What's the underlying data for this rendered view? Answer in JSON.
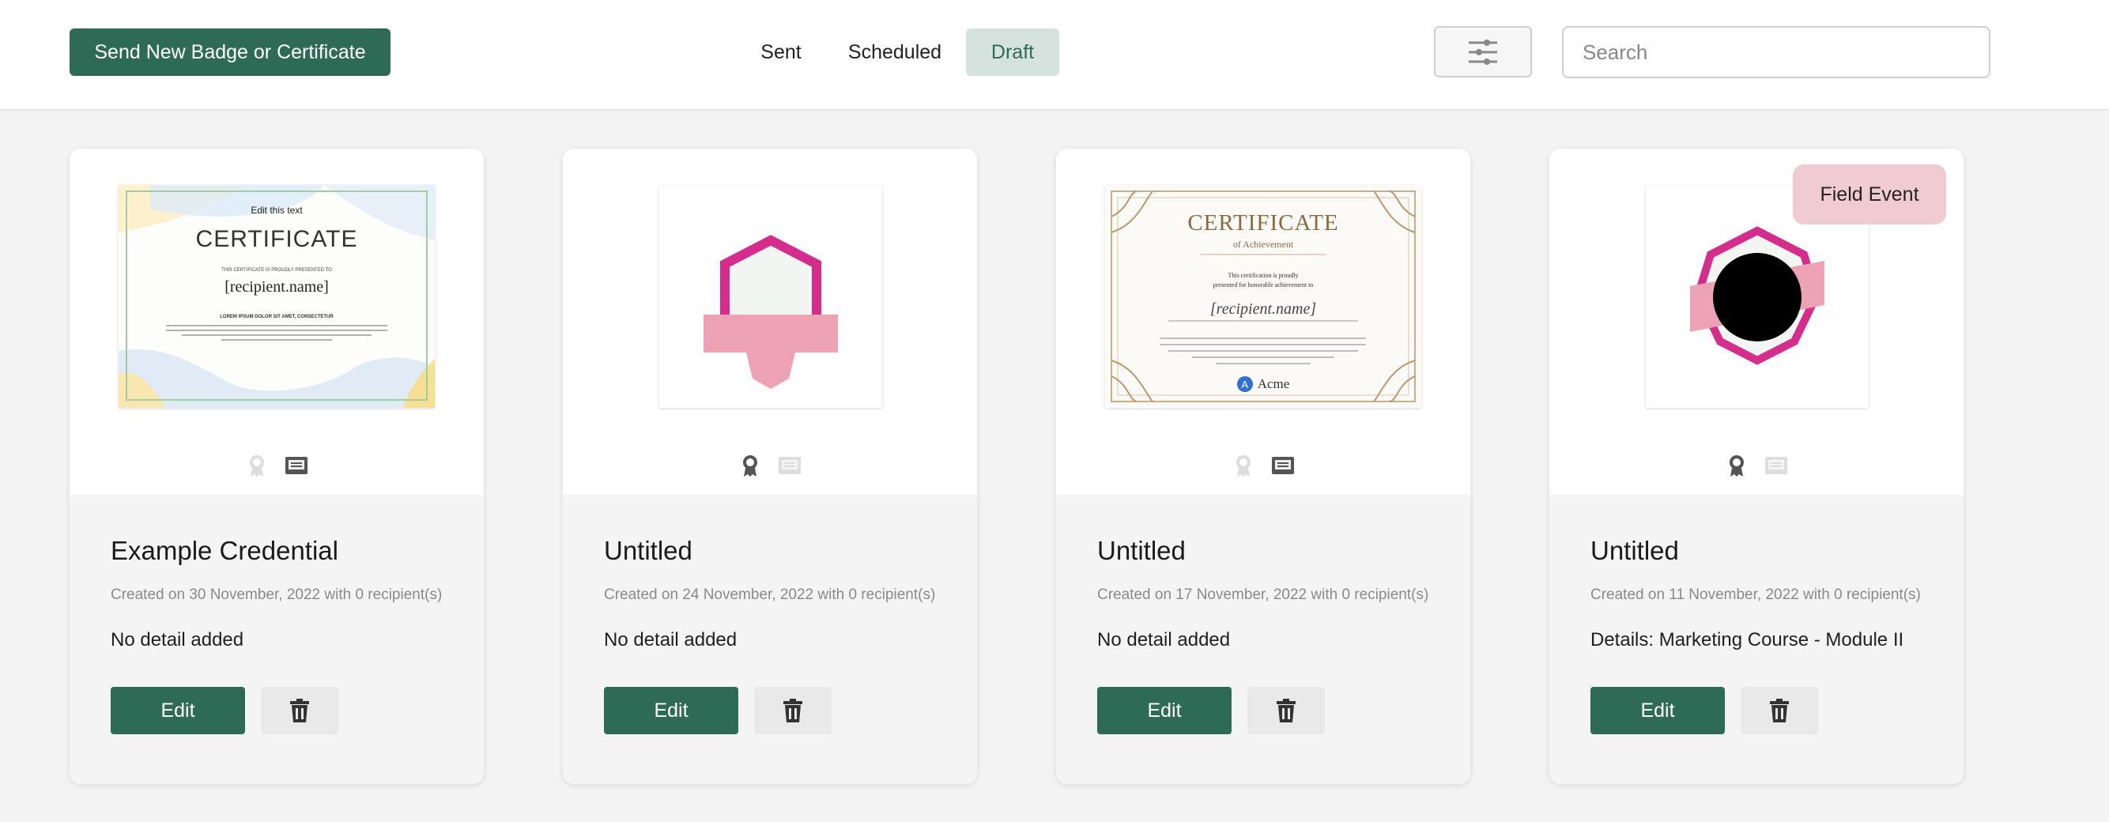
{
  "toolbar": {
    "send_label": "Send New Badge or Certificate",
    "tabs": [
      {
        "label": "Sent",
        "active": false
      },
      {
        "label": "Scheduled",
        "active": false
      },
      {
        "label": "Draft",
        "active": true
      }
    ],
    "filter_icon": "sliders-icon",
    "search_placeholder": "Search",
    "search_value": ""
  },
  "colors": {
    "primary": "#2e6b57",
    "active_tab_bg": "#d6e2de",
    "badge_pink": "#d62d8c",
    "ribbon_pink": "#eda3b4",
    "tag_bg": "#f0ccd2"
  },
  "cards": [
    {
      "title": "Example Credential",
      "meta": "Created on 30 November, 2022 with 0 recipient(s)",
      "detail": "No detail added",
      "edit_label": "Edit",
      "tag": "",
      "thumb": {
        "edit_text": "Edit this text",
        "heading": "CERTIFICATE",
        "presented": "THIS CERTIFICATE IS PROUDLY PRESENTED TO",
        "recipient": "[recipient.name]",
        "lorem_heading": "LOREM IPSUM DOLOR SIT AMET, CONSECTETUR"
      }
    },
    {
      "title": "Untitled",
      "meta": "Created on 24 November, 2022 with 0 recipient(s)",
      "detail": "No detail added",
      "edit_label": "Edit",
      "tag": ""
    },
    {
      "title": "Untitled",
      "meta": "Created on 17 November, 2022 with 0 recipient(s)",
      "detail": "No detail added",
      "edit_label": "Edit",
      "tag": "",
      "thumb": {
        "heading": "CERTIFICATE",
        "subheading": "of Achievement",
        "line1": "This certification is proudly",
        "line2": "presented for honorable achievement to",
        "recipient": "[recipient.name]",
        "logo_letter": "A",
        "logo_text": "Acme"
      }
    },
    {
      "title": "Untitled",
      "meta": "Created on 11 November, 2022 with 0 recipient(s)",
      "detail": "Details: Marketing Course - Module II",
      "edit_label": "Edit",
      "tag": "Field Event"
    }
  ]
}
